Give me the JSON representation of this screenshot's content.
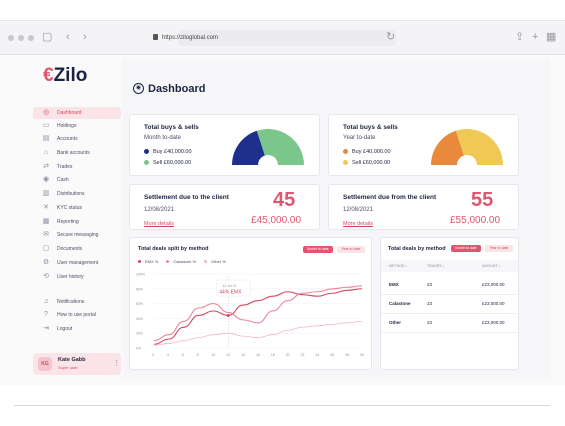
{
  "browser": {
    "url": "https://ziloglobal.com"
  },
  "app": {
    "logo": "Zilo",
    "page_title": "Dashboard"
  },
  "sidebar": {
    "items": [
      {
        "label": "Dashboard",
        "icon": "dashboard-icon",
        "glyph": "◎",
        "active": true
      },
      {
        "label": "Holdings",
        "icon": "holdings-icon",
        "glyph": "▭"
      },
      {
        "label": "Accounts",
        "icon": "accounts-icon",
        "glyph": "▤"
      },
      {
        "label": "Bank accounts",
        "icon": "bank-icon",
        "glyph": "⌂"
      },
      {
        "label": "Trades",
        "icon": "trades-icon",
        "glyph": "⇄"
      },
      {
        "label": "Cash",
        "icon": "cash-icon",
        "glyph": "◉"
      },
      {
        "label": "Distributions",
        "icon": "distributions-icon",
        "glyph": "▥"
      },
      {
        "label": "KYC status",
        "icon": "kyc-icon",
        "glyph": "✕"
      },
      {
        "label": "Reporting",
        "icon": "reporting-icon",
        "glyph": "▦"
      },
      {
        "label": "Secure messaging",
        "icon": "messaging-icon",
        "glyph": "✉"
      },
      {
        "label": "Documents",
        "icon": "documents-icon",
        "glyph": "▢"
      },
      {
        "label": "User management",
        "icon": "user-management-icon",
        "glyph": "⚙"
      },
      {
        "label": "User history",
        "icon": "user-history-icon",
        "glyph": "⟲"
      },
      {
        "label": "Notifications",
        "icon": "bell-icon",
        "glyph": "♫"
      },
      {
        "label": "How to use portal",
        "icon": "help-icon",
        "glyph": "?"
      },
      {
        "label": "Logout",
        "icon": "logout-icon",
        "glyph": "⇥"
      }
    ],
    "user": {
      "initials": "KG",
      "name": "Kate Gabb",
      "role": "Super user"
    }
  },
  "cards": {
    "buys_month": {
      "title": "Total buys & sells",
      "subtitle": "Month to-date",
      "buy_label": "Buy £40,000.00",
      "sell_label": "Sell £60,000.00",
      "buy_color": "#1f2f8c",
      "sell_color": "#7bc68a",
      "buy_share": 0.4
    },
    "buys_year": {
      "title": "Total buys & sells",
      "subtitle": "Year to-date",
      "buy_label": "Buy £40,000.00",
      "sell_label": "Sell £60,000.00",
      "buy_color": "#e8893c",
      "sell_color": "#f0c855",
      "buy_share": 0.4
    },
    "settle_to": {
      "title": "Settlement due to the client",
      "date": "12/08/2021",
      "count": "45",
      "amount": "£45,000.00",
      "link": "More details"
    },
    "settle_from": {
      "title": "Settlement due from the client",
      "date": "12/08/2021",
      "count": "55",
      "amount": "£55,000.00",
      "link": "More details"
    }
  },
  "deals_chart": {
    "title": "Total deals split by method",
    "tab_month": "Month to date",
    "tab_year": "Year to date",
    "tooltip_date": "12 Jul 21",
    "tooltip_value": "44% EMX"
  },
  "chart_data": {
    "type": "line",
    "x": [
      2,
      4,
      6,
      8,
      10,
      12,
      14,
      16,
      18,
      20,
      22,
      24,
      26,
      28,
      30
    ],
    "y_ticks": [
      "100%",
      "80%",
      "60%",
      "40%",
      "20%",
      "0%"
    ],
    "ylim": [
      0,
      100
    ],
    "series": [
      {
        "name": "EMX %",
        "color": "#d6475f",
        "values": [
          5,
          12,
          28,
          44,
          50,
          44,
          58,
          64,
          70,
          76,
          72,
          70,
          74,
          78,
          80
        ]
      },
      {
        "name": "Calastone %",
        "color": "#e8899a",
        "values": [
          10,
          18,
          36,
          54,
          60,
          48,
          38,
          34,
          50,
          64,
          74,
          76,
          80,
          82,
          84
        ]
      },
      {
        "name": "Other %",
        "color": "#f2b8c3",
        "values": [
          4,
          6,
          10,
          14,
          18,
          20,
          16,
          14,
          18,
          24,
          28,
          30,
          32,
          34,
          36
        ]
      }
    ]
  },
  "deals_table": {
    "title": "Total deals by method",
    "tab_month": "Month to date",
    "tab_year": "Year to date",
    "headers": [
      "METHOD ↕",
      "TRADES ↕",
      "AMOUNT ↕"
    ],
    "rows": [
      [
        "EMX",
        "23",
        "£23,000.00"
      ],
      [
        "Calastone",
        "23",
        "£23,000.00"
      ],
      [
        "Other",
        "23",
        "£23,000.00"
      ]
    ]
  }
}
